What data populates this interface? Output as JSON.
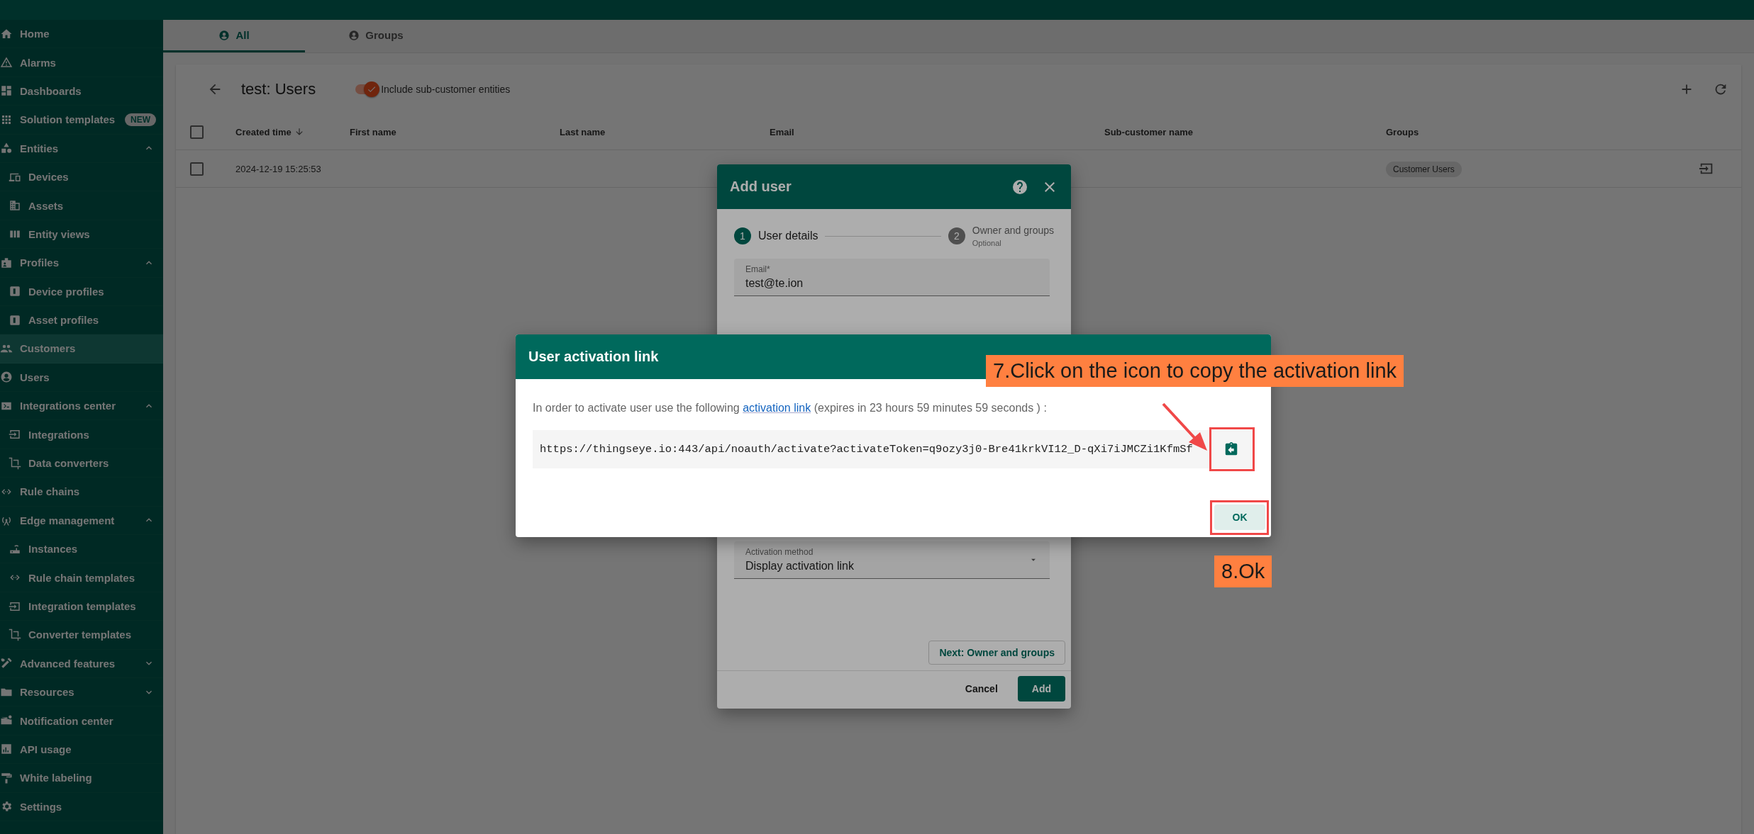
{
  "sidebar": {
    "items": [
      {
        "label": "Home",
        "selected": false
      },
      {
        "label": "Alarms",
        "selected": false
      },
      {
        "label": "Dashboards",
        "selected": false
      },
      {
        "label": "Solution templates",
        "badge": "NEW",
        "selected": false
      },
      {
        "label": "Entities",
        "selected": false,
        "expanded": true,
        "children": [
          {
            "label": "Devices",
            "selected": false
          },
          {
            "label": "Assets",
            "selected": false
          },
          {
            "label": "Entity views",
            "selected": false
          }
        ]
      },
      {
        "label": "Profiles",
        "selected": false,
        "expanded": true,
        "children": [
          {
            "label": "Device profiles",
            "selected": false
          },
          {
            "label": "Asset profiles",
            "selected": false
          }
        ]
      },
      {
        "label": "Customers",
        "selected": true
      },
      {
        "label": "Users",
        "selected": false
      },
      {
        "label": "Integrations center",
        "selected": false,
        "expanded": true,
        "children": [
          {
            "label": "Integrations",
            "selected": false
          },
          {
            "label": "Data converters",
            "selected": false
          }
        ]
      },
      {
        "label": "Rule chains",
        "selected": false
      },
      {
        "label": "Edge management",
        "selected": false,
        "expanded": true,
        "children": [
          {
            "label": "Instances",
            "selected": false
          },
          {
            "label": "Rule chain templates",
            "selected": false
          },
          {
            "label": "Integration templates",
            "selected": false
          },
          {
            "label": "Converter templates",
            "selected": false
          }
        ]
      },
      {
        "label": "Advanced features",
        "selected": false,
        "expanded": false
      },
      {
        "label": "Resources",
        "selected": false,
        "expanded": false
      },
      {
        "label": "Notification center",
        "selected": false
      },
      {
        "label": "API usage",
        "selected": false
      },
      {
        "label": "White labeling",
        "selected": false
      },
      {
        "label": "Settings",
        "selected": false
      }
    ]
  },
  "tabs": [
    {
      "label": "All",
      "selected": true
    },
    {
      "label": "Groups",
      "selected": false
    }
  ],
  "users_panel": {
    "title": "test: Users",
    "include_toggle": {
      "label": "Include sub-customer entities",
      "on": true
    },
    "table": {
      "select_all_checked": false,
      "columns": [
        {
          "label": "Created time",
          "sorted": true
        },
        {
          "label": "First name",
          "sorted": false
        },
        {
          "label": "Last name",
          "sorted": false
        },
        {
          "label": "Email",
          "sorted": false
        },
        {
          "label": "Sub-customer name",
          "sorted": false
        },
        {
          "label": "Groups",
          "sorted": false
        }
      ],
      "rows": [
        {
          "checked": false,
          "created_time": "2024-12-19 15:25:53",
          "groups": [
            "Customer Users"
          ]
        }
      ]
    }
  },
  "add_user_dialog": {
    "title": "Add user",
    "steps": [
      {
        "number": "1",
        "label": "User details",
        "selected": true
      },
      {
        "number": "2",
        "label": "Owner and groups",
        "hint": "Optional",
        "selected": false
      }
    ],
    "email_field": {
      "label": "Email*",
      "value": "test@te.ion"
    },
    "activation_method_field": {
      "label": "Activation method",
      "value": "Display activation link"
    },
    "next_button": "Next: Owner and groups",
    "cancel_button": "Cancel",
    "add_button": "Add"
  },
  "activation_dialog": {
    "title": "User activation link",
    "message_before": "In order to activate user use the following ",
    "link_text": "activation link",
    "message_after": " (expires in 23 hours 59 minutes 59 seconds ) :",
    "url": "https://thingseye.io:443/api/noauth/activate?activateToken=q9ozy3j0-Bre41krkVI12_D-qXi7iJMCZi1KfmSf",
    "ok_button": "OK"
  },
  "annotations": [
    {
      "text": "7.Click on the icon to copy the activation link"
    },
    {
      "text": "8.Ok"
    }
  ]
}
